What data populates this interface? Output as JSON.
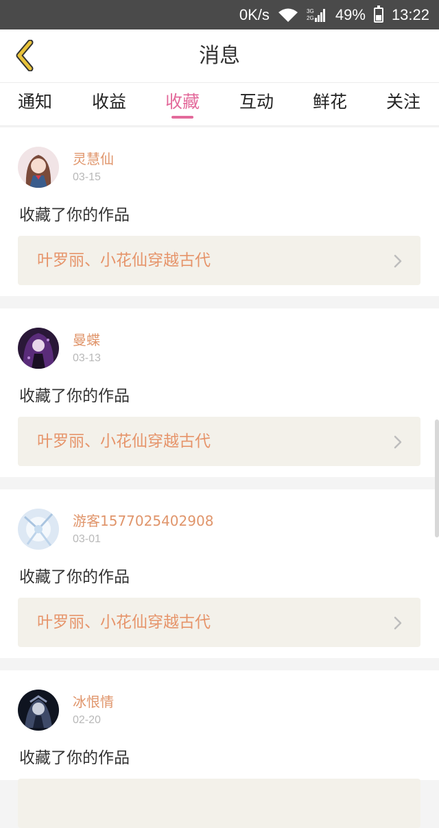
{
  "status_bar": {
    "net_speed": "0K/s",
    "signal_label": "3G 2G",
    "battery": "49%",
    "time": "13:22",
    "battery_level": 0.49
  },
  "header": {
    "title": "消息",
    "back_icon": "chevron-left-icon",
    "accent_color": "#e8c23a"
  },
  "tabs": [
    {
      "label": "通知",
      "active": false
    },
    {
      "label": "收益",
      "active": false
    },
    {
      "label": "收藏",
      "active": true
    },
    {
      "label": "互动",
      "active": false
    },
    {
      "label": "鲜花",
      "active": false
    },
    {
      "label": "关注",
      "active": false
    }
  ],
  "active_tab_color": "#e36a9b",
  "messages": [
    {
      "username": "灵慧仙",
      "date": "03-15",
      "action": "收藏了你的作品",
      "work_title": "叶罗丽、小花仙穿越古代"
    },
    {
      "username": "曼蝶",
      "date": "03-13",
      "action": "收藏了你的作品",
      "work_title": "叶罗丽、小花仙穿越古代"
    },
    {
      "username": "游客1577025402908",
      "date": "03-01",
      "action": "收藏了你的作品",
      "work_title": "叶罗丽、小花仙穿越古代"
    },
    {
      "username": "冰恨情",
      "date": "02-20",
      "action": "收藏了你的作品",
      "work_title": ""
    }
  ]
}
